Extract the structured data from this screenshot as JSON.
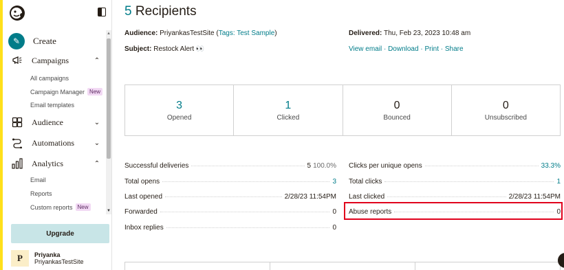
{
  "sidebar": {
    "create_label": "Create",
    "campaigns": {
      "label": "Campaigns",
      "items": [
        {
          "label": "All campaigns"
        },
        {
          "label": "Campaign Manager",
          "badge": "New"
        },
        {
          "label": "Email templates"
        }
      ]
    },
    "audience_label": "Audience",
    "automations_label": "Automations",
    "analytics": {
      "label": "Analytics",
      "items": [
        {
          "label": "Email"
        },
        {
          "label": "Reports"
        },
        {
          "label": "Custom reports",
          "badge": "New"
        }
      ]
    },
    "upgrade_label": "Upgrade",
    "user": {
      "initial": "P",
      "name": "Priyanka",
      "site": "PriyankasTestSite"
    }
  },
  "header": {
    "count": "5",
    "title_suffix": " Recipients"
  },
  "meta": {
    "audience_label": "Audience:",
    "audience_value": "PriyankasTestSite",
    "tags_prefix": "(",
    "tags_link": "Tags: Test Sample",
    "tags_suffix": ")",
    "subject_label": "Subject:",
    "subject_value": "Restock Alert 👀",
    "delivered_label": "Delivered:",
    "delivered_value": "Thu, Feb 23, 2023 10:48 am",
    "links": {
      "view_email": "View email",
      "download": "Download",
      "print": "Print",
      "share": "Share",
      "separator": " · "
    }
  },
  "stats": [
    {
      "value": "3",
      "label": "Opened"
    },
    {
      "value": "1",
      "label": "Clicked"
    },
    {
      "value": "0",
      "label": "Bounced"
    },
    {
      "value": "0",
      "label": "Unsubscribed"
    }
  ],
  "metrics_left": [
    {
      "label": "Successful deliveries",
      "value": "5",
      "pct": "100.0%"
    },
    {
      "label": "Total opens",
      "value": "3"
    },
    {
      "label": "Last opened",
      "value": "2/28/23 11:54PM"
    },
    {
      "label": "Forwarded",
      "value": "0"
    },
    {
      "label": "Inbox replies",
      "value": "0"
    }
  ],
  "metrics_right": [
    {
      "label": "Clicks per unique opens",
      "value": "33.3%"
    },
    {
      "label": "Total clicks",
      "value": "1"
    },
    {
      "label": "Last clicked",
      "value": "2/28/23 11:54PM"
    },
    {
      "label": "Abuse reports",
      "value": "0"
    }
  ],
  "colors": {
    "accent": "#007c89",
    "brand_yellow": "#ffe01b",
    "highlight_red": "#e0001b"
  }
}
